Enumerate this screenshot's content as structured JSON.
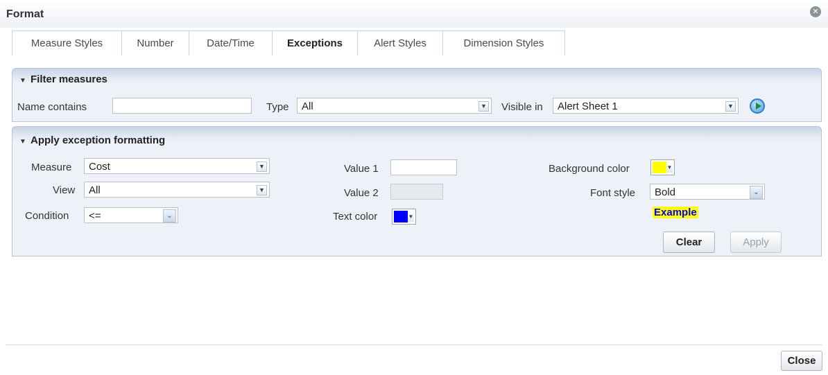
{
  "window": {
    "title": "Format",
    "close_icon": "close-icon"
  },
  "tabs": [
    {
      "label": "Measure Styles"
    },
    {
      "label": "Number"
    },
    {
      "label": "Date/Time"
    },
    {
      "label": "Exceptions",
      "active": true
    },
    {
      "label": "Alert Styles"
    },
    {
      "label": "Dimension Styles"
    }
  ],
  "filter": {
    "header": "Filter measures",
    "name_label": "Name contains",
    "name_value": "",
    "type_label": "Type",
    "type_value": "All",
    "visible_label": "Visible in",
    "visible_value": "Alert Sheet 1"
  },
  "exception": {
    "header": "Apply exception formatting",
    "measure_label": "Measure",
    "measure_value": "Cost",
    "view_label": "View",
    "view_value": "All",
    "condition_label": "Condition",
    "condition_value": "<=",
    "value1_label": "Value 1",
    "value1_value": "",
    "value2_label": "Value 2",
    "value2_value": "",
    "text_color_label": "Text color",
    "text_color": "#0000ff",
    "bg_color_label": "Background color",
    "bg_color": "#ffff00",
    "font_style_label": "Font style",
    "font_style_value": "Bold",
    "example_text": "Example",
    "clear_label": "Clear",
    "apply_label": "Apply"
  },
  "footer": {
    "close_label": "Close"
  }
}
